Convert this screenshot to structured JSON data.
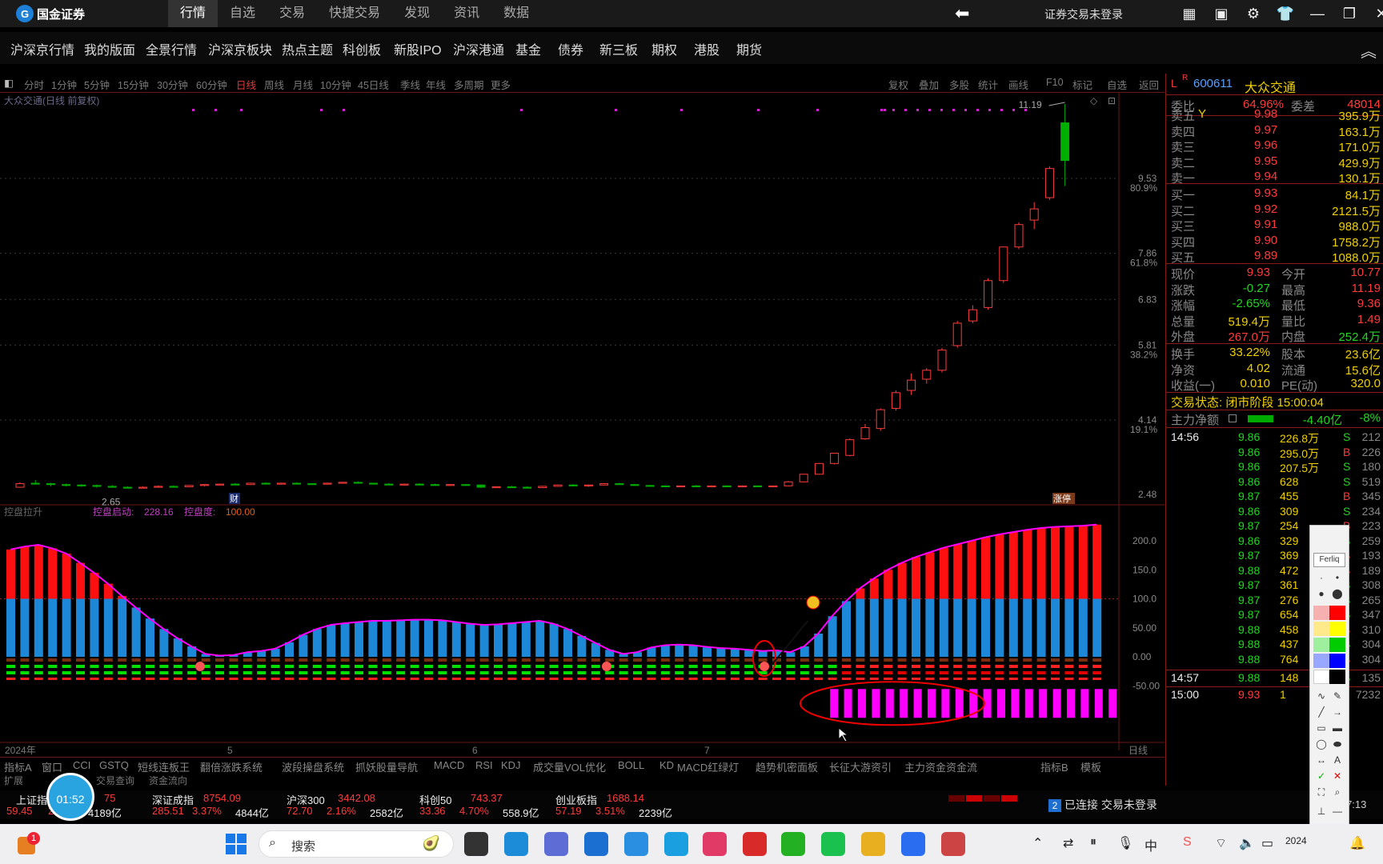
{
  "app": {
    "logo_text": "国金证券",
    "login_status": "证券交易未登录"
  },
  "main_nav": [
    "行情",
    "自选",
    "交易",
    "快捷交易",
    "发现",
    "资讯",
    "数据"
  ],
  "main_nav_active": 0,
  "market_tabs": [
    "沪深京行情",
    "我的版面",
    "全景行情",
    "沪深京板块",
    "热点主题",
    "科创板",
    "新股IPO",
    "沪深港通",
    "基金",
    "债券",
    "新三板",
    "期权",
    "港股",
    "期货"
  ],
  "periods": [
    "分时",
    "1分钟",
    "5分钟",
    "15分钟",
    "30分钟",
    "60分钟",
    "日线",
    "周线",
    "月线",
    "10分钟",
    "45日线",
    "季线",
    "年线",
    "多周期",
    "更多"
  ],
  "period_active": "日线",
  "chart_tools": [
    "复权",
    "叠加",
    "多股",
    "统计",
    "画线",
    "F10",
    "标记",
    "自选",
    "返回"
  ],
  "stock": {
    "code": "600611",
    "name": "大众交通",
    "chart_caption": "大众交通(日线 前复权)"
  },
  "chart_data": {
    "type": "candlestick",
    "price_axis": [
      "11.19",
      "9.53",
      "7.86",
      "6.83",
      "5.81",
      "4.14",
      "2.48"
    ],
    "pct_axis": [
      "80.9%",
      "61.8%",
      "38.2%",
      "19.1%"
    ],
    "annotations": {
      "high_label": "11.19",
      "low_label": "2.65",
      "fin_marker": "财",
      "limit_marker": "涨停"
    },
    "x_labels": [
      "2024年",
      "5",
      "6",
      "7"
    ],
    "period_label": "日线",
    "candles": [
      [
        2.64,
        2.75,
        2.63,
        2.72
      ],
      [
        2.73,
        2.8,
        2.7,
        2.72
      ],
      [
        2.72,
        2.74,
        2.66,
        2.7
      ],
      [
        2.7,
        2.72,
        2.66,
        2.69
      ],
      [
        2.69,
        2.71,
        2.65,
        2.68
      ],
      [
        2.68,
        2.7,
        2.63,
        2.66
      ],
      [
        2.66,
        2.69,
        2.63,
        2.64
      ],
      [
        2.64,
        2.66,
        2.61,
        2.63
      ],
      [
        2.63,
        2.66,
        2.62,
        2.64
      ],
      [
        2.64,
        2.68,
        2.63,
        2.66
      ],
      [
        2.66,
        2.68,
        2.63,
        2.65
      ],
      [
        2.65,
        2.69,
        2.64,
        2.68
      ],
      [
        2.68,
        2.71,
        2.66,
        2.7
      ],
      [
        2.7,
        2.72,
        2.68,
        2.71
      ],
      [
        2.71,
        2.73,
        2.69,
        2.7
      ],
      [
        2.7,
        2.74,
        2.69,
        2.73
      ],
      [
        2.73,
        2.75,
        2.7,
        2.72
      ],
      [
        2.72,
        2.74,
        2.7,
        2.73
      ],
      [
        2.73,
        2.75,
        2.71,
        2.72
      ],
      [
        2.72,
        2.73,
        2.7,
        2.71
      ],
      [
        2.71,
        2.74,
        2.7,
        2.73
      ],
      [
        2.73,
        2.76,
        2.72,
        2.75
      ],
      [
        2.75,
        2.77,
        2.72,
        2.73
      ],
      [
        2.73,
        2.74,
        2.7,
        2.71
      ],
      [
        2.71,
        2.73,
        2.69,
        2.7
      ],
      [
        2.7,
        2.72,
        2.68,
        2.71
      ],
      [
        2.71,
        2.73,
        2.69,
        2.7
      ],
      [
        2.7,
        2.72,
        2.68,
        2.69
      ],
      [
        2.69,
        2.71,
        2.67,
        2.7
      ],
      [
        2.7,
        2.71,
        2.68,
        2.69
      ],
      [
        2.69,
        2.7,
        2.62,
        2.64
      ],
      [
        2.64,
        2.66,
        2.62,
        2.65
      ],
      [
        2.65,
        2.67,
        2.63,
        2.64
      ],
      [
        2.64,
        2.66,
        2.62,
        2.63
      ],
      [
        2.63,
        2.67,
        2.62,
        2.66
      ],
      [
        2.66,
        2.7,
        2.65,
        2.69
      ],
      [
        2.69,
        2.71,
        2.66,
        2.67
      ],
      [
        2.67,
        2.7,
        2.65,
        2.69
      ],
      [
        2.69,
        2.73,
        2.68,
        2.72
      ],
      [
        2.72,
        2.74,
        2.69,
        2.7
      ],
      [
        2.7,
        2.71,
        2.67,
        2.68
      ],
      [
        2.68,
        2.69,
        2.66,
        2.67
      ],
      [
        2.67,
        2.68,
        2.65,
        2.66
      ],
      [
        2.66,
        2.68,
        2.64,
        2.67
      ],
      [
        2.67,
        2.69,
        2.65,
        2.66
      ],
      [
        2.66,
        2.68,
        2.64,
        2.67
      ],
      [
        2.67,
        2.68,
        2.65,
        2.66
      ],
      [
        2.66,
        2.68,
        2.65,
        2.67
      ],
      [
        2.67,
        2.68,
        2.64,
        2.65
      ],
      [
        2.65,
        2.68,
        2.64,
        2.67
      ],
      [
        2.67,
        2.78,
        2.66,
        2.76
      ],
      [
        2.76,
        2.94,
        2.75,
        2.93
      ],
      [
        2.93,
        3.18,
        2.92,
        3.17
      ],
      [
        3.17,
        3.4,
        3.15,
        3.4
      ],
      [
        3.35,
        3.73,
        3.33,
        3.7
      ],
      [
        3.72,
        4.05,
        3.7,
        3.97
      ],
      [
        3.95,
        4.4,
        3.9,
        4.37
      ],
      [
        4.4,
        4.8,
        4.35,
        4.75
      ],
      [
        4.8,
        5.18,
        4.7,
        5.03
      ],
      [
        5.05,
        5.3,
        4.95,
        5.25
      ],
      [
        5.25,
        5.75,
        5.2,
        5.7
      ],
      [
        5.8,
        6.35,
        5.75,
        6.3
      ],
      [
        6.35,
        6.7,
        6.3,
        6.6
      ],
      [
        6.65,
        7.3,
        6.6,
        7.25
      ],
      [
        7.25,
        8.0,
        7.2,
        8.0
      ],
      [
        8.0,
        8.55,
        7.95,
        8.5
      ],
      [
        8.6,
        9.0,
        8.4,
        8.85
      ],
      [
        9.1,
        9.8,
        9.05,
        9.75
      ],
      [
        10.77,
        11.19,
        9.36,
        9.93
      ]
    ],
    "indicator": {
      "name": "控盘拉升",
      "caption_prefix": "控盘拉升",
      "caption_a_label": "控盘启动:",
      "caption_a_value": "228.16",
      "caption_b_label": "控盘度:",
      "caption_b_value": "100.00",
      "axis": [
        "200.0",
        "150.0",
        "100.0",
        "50.00",
        "0.00",
        "-50.00"
      ],
      "values": [
        185,
        190,
        193,
        187,
        178,
        162,
        145,
        126,
        105,
        85,
        66,
        48,
        32,
        18,
        5,
        2,
        3,
        8,
        10,
        14,
        25,
        38,
        48,
        55,
        58,
        60,
        62,
        62,
        63,
        64,
        64,
        63,
        60,
        57,
        55,
        56,
        58,
        60,
        62,
        57,
        48,
        36,
        24,
        12,
        5,
        8,
        16,
        20,
        21,
        20,
        17,
        15,
        14,
        12,
        10,
        11,
        8,
        18,
        40,
        70,
        96,
        118,
        135,
        150,
        162,
        172,
        180,
        188,
        194,
        200,
        206,
        211,
        215,
        219,
        222,
        224,
        225,
        226,
        228
      ]
    }
  },
  "quote": {
    "header": {
      "prefix": "L",
      "flag": "R"
    },
    "weibi_label": "委比",
    "weibi_value": "64.96%",
    "weicha_label": "委差",
    "weicha_value": "48014",
    "asks": [
      {
        "label": "卖五",
        "flag": "Y",
        "price": "9.98",
        "vol": "395.9万"
      },
      {
        "label": "卖四",
        "price": "9.97",
        "vol": "163.1万"
      },
      {
        "label": "卖三",
        "price": "9.96",
        "vol": "171.0万"
      },
      {
        "label": "卖二",
        "price": "9.95",
        "vol": "429.9万"
      },
      {
        "label": "卖一",
        "price": "9.94",
        "vol": "130.1万"
      }
    ],
    "bids": [
      {
        "label": "买一",
        "price": "9.93",
        "vol": "84.1万"
      },
      {
        "label": "买二",
        "price": "9.92",
        "vol": "2121.5万"
      },
      {
        "label": "买三",
        "price": "9.91",
        "vol": "988.0万"
      },
      {
        "label": "买四",
        "price": "9.90",
        "vol": "1758.2万"
      },
      {
        "label": "买五",
        "price": "9.89",
        "vol": "1088.0万"
      }
    ],
    "stats": [
      {
        "l1": "现价",
        "v1": "9.93",
        "c1": "red",
        "l2": "今开",
        "v2": "10.77",
        "c2": "red"
      },
      {
        "l1": "涨跌",
        "v1": "-0.27",
        "c1": "green",
        "l2": "最高",
        "v2": "11.19",
        "c2": "red"
      },
      {
        "l1": "涨幅",
        "v1": "-2.65%",
        "c1": "green",
        "l2": "最低",
        "v2": "9.36",
        "c2": "red"
      },
      {
        "l1": "总量",
        "v1": "519.4万",
        "c1": "yellow",
        "l2": "量比",
        "v2": "1.49",
        "c2": "red"
      },
      {
        "l1": "外盘",
        "v1": "267.0万",
        "c1": "red",
        "l2": "内盘",
        "v2": "252.4万",
        "c2": "green"
      }
    ],
    "fund": [
      {
        "l1": "换手",
        "v1": "33.22%",
        "l2": "股本",
        "v2": "23.6亿"
      },
      {
        "l1": "净资",
        "v1": "4.02",
        "l2": "流通",
        "v2": "15.6亿"
      },
      {
        "l1": "收益(一)",
        "v1": "0.010",
        "l2": "PE(动)",
        "v2": "320.0"
      }
    ],
    "trade_status": "交易状态: 闭市阶段 15:00:04",
    "main_net_label": "主力净额",
    "main_net_value": "-4.40亿",
    "main_net_pct": "-8%",
    "ticks_time": "14:56",
    "ticks": [
      {
        "p": "9.86",
        "v": "226.8万",
        "bs": "S",
        "n": "212"
      },
      {
        "p": "9.86",
        "v": "295.0万",
        "bs": "B",
        "n": "226"
      },
      {
        "p": "9.86",
        "v": "207.5万",
        "bs": "S",
        "n": "180"
      },
      {
        "p": "9.86",
        "v": "628",
        "bs": "S",
        "n": "519"
      },
      {
        "p": "9.87",
        "v": "455",
        "bs": "B",
        "n": "345"
      },
      {
        "p": "9.86",
        "v": "309",
        "bs": "S",
        "n": "234"
      },
      {
        "p": "9.87",
        "v": "254",
        "bs": "B",
        "n": "223"
      },
      {
        "p": "9.86",
        "v": "329",
        "bs": "S",
        "n": "259"
      },
      {
        "p": "9.87",
        "v": "369",
        "bs": "B",
        "n": "193"
      },
      {
        "p": "9.88",
        "v": "472",
        "bs": "B",
        "n": "189"
      },
      {
        "p": "9.87",
        "v": "361",
        "bs": "S",
        "n": "308"
      },
      {
        "p": "9.87",
        "v": "276",
        "bs": "S",
        "n": "265"
      },
      {
        "p": "9.87",
        "v": "654",
        "bs": "S",
        "n": "347"
      },
      {
        "p": "9.88",
        "v": "458",
        "bs": "B",
        "n": "310"
      },
      {
        "p": "9.88",
        "v": "437",
        "bs": "S",
        "n": "304"
      },
      {
        "p": "9.88",
        "v": "764",
        "bs": "B",
        "n": "304"
      }
    ],
    "tick_1457": {
      "t": "14:57",
      "p": "9.88",
      "v": "148",
      "bs": "S",
      "n": "135"
    },
    "tick_1500": {
      "t": "15:00",
      "p": "9.93",
      "v": "1",
      "n": "7232"
    }
  },
  "indicator_tabs": [
    "指标A",
    "窗口",
    "CCI",
    "GSTQ",
    "短线连板王",
    "翻倍涨跌系统",
    "波段操盘系统",
    "抓妖股量导航",
    "MACD",
    "RSI",
    "KDJ",
    "成交量VOL优化",
    "BOLL",
    "KD",
    "MACD红绿灯",
    "趋势机密面板",
    "长征大游资引",
    "主力资金资金流",
    "指标B",
    "模板"
  ],
  "indicator_tabs2": [
    "扩展",
    "关联",
    "交易查询",
    "资金流向"
  ],
  "indices": [
    {
      "name": "上证指数",
      "v1": "75",
      "v2": "59.45",
      "v3": "2",
      "v4": "4189亿"
    },
    {
      "name": "深证成指",
      "v1": "8754.09",
      "v2": "285.51",
      "v3": "3.37%",
      "v4": "4844亿"
    },
    {
      "name": "沪深300",
      "v1": "3442.08",
      "v2": "72.70",
      "v3": "2.16%",
      "v4": "2582亿"
    },
    {
      "name": "科创50",
      "v1": "743.37",
      "v2": "33.36",
      "v3": "4.70%",
      "v4": "558.9亿"
    },
    {
      "name": "创业板指",
      "v1": "1688.14",
      "v2": "57.19",
      "v3": "3.51%",
      "v4": "2239亿"
    }
  ],
  "time_bubble": "01:52",
  "connection": {
    "badge": "2",
    "text": "已连接 交易未登录"
  },
  "clock_partial": "8:17:13",
  "taskbar": {
    "search_label": "搜索",
    "notify_count": "1",
    "date_partial": "2024"
  },
  "drawtools": {
    "title": "Ferliq"
  },
  "colors": {
    "up": "#ff3b3b",
    "down": "#00a800",
    "bar_blue": "#1e88d8",
    "bar_red": "#ff1010",
    "magenta": "#ff00ff"
  }
}
